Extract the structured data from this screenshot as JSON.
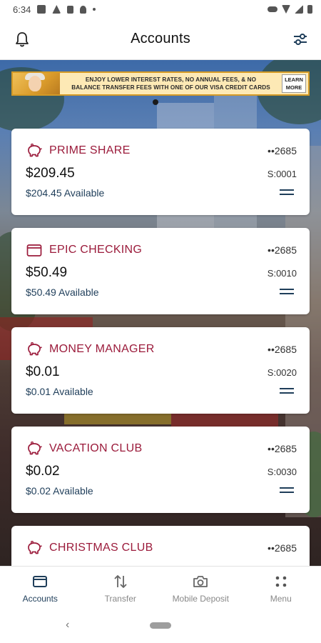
{
  "status_bar": {
    "time": "6:34"
  },
  "header": {
    "title": "Accounts"
  },
  "banner": {
    "line1": "ENJOY LOWER INTEREST RATES, NO ANNUAL FEES, & NO",
    "line2": "BALANCE TRANSFER FEES WITH ONE OF OUR VISA CREDIT CARDS",
    "learn_line1": "LEARN",
    "learn_line2": "MORE"
  },
  "accounts": [
    {
      "name": "PRIME SHARE",
      "icon": "piggy-bank-icon",
      "number": "••2685",
      "balance": "$209.45",
      "suffix": "S:0001",
      "available": "$204.45 Available"
    },
    {
      "name": "EPIC CHECKING",
      "icon": "wallet-icon",
      "number": "••2685",
      "balance": "$50.49",
      "suffix": "S:0010",
      "available": "$50.49 Available"
    },
    {
      "name": "MONEY MANAGER",
      "icon": "piggy-bank-icon",
      "number": "••2685",
      "balance": "$0.01",
      "suffix": "S:0020",
      "available": "$0.01 Available"
    },
    {
      "name": "VACATION CLUB",
      "icon": "piggy-bank-icon",
      "number": "••2685",
      "balance": "$0.02",
      "suffix": "S:0030",
      "available": "$0.02 Available"
    },
    {
      "name": "CHRISTMAS CLUB",
      "icon": "piggy-bank-icon",
      "number": "••2685"
    }
  ],
  "bottom_nav": [
    {
      "label": "Accounts",
      "icon": "wallet-icon",
      "active": true
    },
    {
      "label": "Transfer",
      "icon": "transfer-arrows-icon",
      "active": false
    },
    {
      "label": "Mobile Deposit",
      "icon": "camera-icon",
      "active": false
    },
    {
      "label": "Menu",
      "icon": "menu-dots-icon",
      "active": false
    }
  ],
  "colors": {
    "brand": "#9b1b3b",
    "navy": "#1f3e5a",
    "banner_bg": "#fde9b5",
    "banner_border": "#d49a26"
  }
}
